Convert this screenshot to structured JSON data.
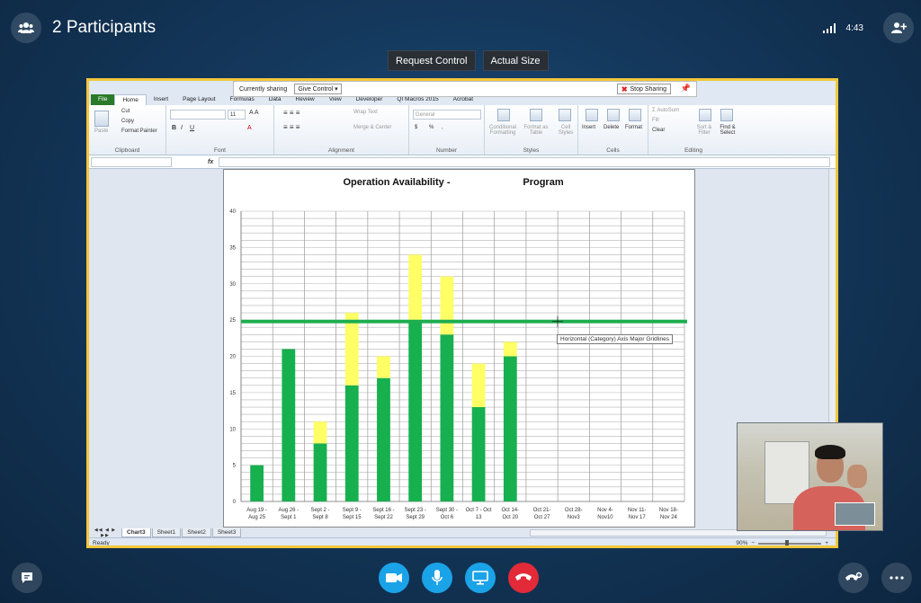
{
  "header": {
    "participants_label": "2 Participants",
    "time": "4:43"
  },
  "controls": {
    "request_control": "Request Control",
    "actual_size": "Actual Size"
  },
  "share_bar": {
    "currently_sharing": "Currently sharing",
    "give_control": "Give Control",
    "stop_sharing": "Stop Sharing"
  },
  "excel": {
    "tabs": [
      "File",
      "Home",
      "Insert",
      "Page Layout",
      "Formulas",
      "Data",
      "Review",
      "View",
      "Developer",
      "QI Macros 2015",
      "Acrobat"
    ],
    "ribbon": {
      "clipboard": {
        "name": "Clipboard",
        "paste": "Paste",
        "cut": "Cut",
        "copy": "Copy",
        "format_painter": "Format Painter"
      },
      "font": {
        "name": "Font",
        "size": "11"
      },
      "alignment": {
        "name": "Alignment",
        "wrap_text": "Wrap Text",
        "merge_center": "Merge & Center"
      },
      "number": {
        "name": "Number",
        "format": "General",
        "currency": "$",
        "percent": "%",
        "comma": ","
      },
      "styles": {
        "name": "Styles",
        "conditional_formatting": "Conditional Formatting",
        "format_as_table": "Format as Table",
        "cell_styles": "Cell Styles"
      },
      "cells": {
        "name": "Cells",
        "insert": "Insert",
        "delete": "Delete",
        "format": "Format"
      },
      "editing": {
        "name": "Editing",
        "autosum": "AutoSum",
        "fill": "Fill",
        "clear": "Clear",
        "sort_filter": "Sort & Filter",
        "find_select": "Find & Select"
      }
    },
    "formula_bar": {
      "fx": "fx"
    },
    "sheet_tabs": [
      "Chart3",
      "Sheet1",
      "Sheet2",
      "Sheet3"
    ],
    "active_sheet": "Chart3",
    "status": "Ready",
    "zoom": "90%",
    "tooltip": "Horizontal (Category) Axis Major Gridlines"
  },
  "chart_data": {
    "type": "bar",
    "title_left": "Operation Availability -",
    "title_right": "Program",
    "categories": [
      [
        "Aug 19 -",
        "Aug 25"
      ],
      [
        "Aug 26 -",
        "Sept 1"
      ],
      [
        "Sept 2 -",
        "Sept 8"
      ],
      [
        "Sept 9 -",
        "Sept 15"
      ],
      [
        "Sept 16 -",
        "Sept 22"
      ],
      [
        "Sept 23 -",
        "Sept 29"
      ],
      [
        "Sept 30 -",
        "Oct 6"
      ],
      [
        "Oct 7 - Oct",
        "13"
      ],
      [
        "Oct 14-",
        "Oct 20"
      ],
      [
        "Oct 21-",
        "Oct 27"
      ],
      [
        "Oct 28-",
        "Nov3"
      ],
      [
        "Nov 4-",
        "Nov10"
      ],
      [
        "Nov 11-",
        "Nov 17"
      ],
      [
        "Nov 18-",
        "Nov 24"
      ]
    ],
    "stacked": true,
    "series": [
      {
        "values": [
          5,
          21,
          8,
          16,
          17,
          25,
          23,
          13,
          20,
          0,
          0,
          0,
          0,
          0
        ],
        "color": "#16b04f"
      },
      {
        "values": [
          0,
          0,
          3,
          10,
          3,
          9,
          8,
          6,
          2,
          0,
          0,
          0,
          0,
          0
        ],
        "color": "#ffff66"
      }
    ],
    "target_line": {
      "value": 24.8,
      "color": "#1fae50"
    },
    "ylim": [
      0,
      40
    ],
    "yticks": [
      0,
      5,
      10,
      15,
      20,
      25,
      30,
      35,
      40
    ],
    "grid": true
  }
}
